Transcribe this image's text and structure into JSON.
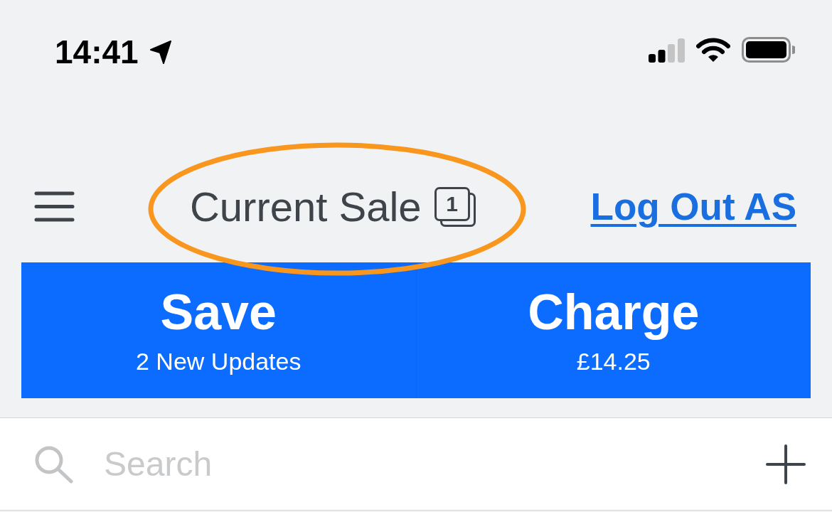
{
  "status_bar": {
    "time": "14:41"
  },
  "header": {
    "title": "Current Sale",
    "badge_count": "1",
    "title_highlighted": true,
    "action": "Log Out AS"
  },
  "actions": [
    {
      "label": "Save",
      "sublabel": "2 New Updates"
    },
    {
      "label": "Charge",
      "sublabel": "£14.25"
    }
  ],
  "search": {
    "placeholder": "Search"
  }
}
